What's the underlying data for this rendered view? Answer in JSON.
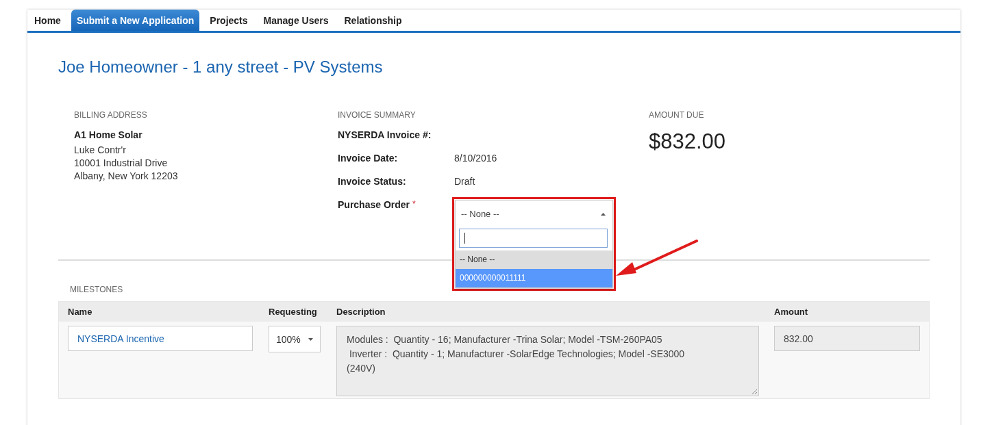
{
  "tabs": [
    {
      "label": "Home",
      "selected": false
    },
    {
      "label": "Submit a New Application",
      "selected": true
    },
    {
      "label": "Projects",
      "selected": false
    },
    {
      "label": "Manage Users",
      "selected": false
    },
    {
      "label": "Relationship",
      "selected": false
    }
  ],
  "title": "Joe Homeowner - 1 any street - PV Systems",
  "billing": {
    "heading": "BILLING ADDRESS",
    "company": "A1 Home Solar",
    "lines": [
      "Luke Contr'r",
      "10001 Industrial Drive",
      "Albany, New York 12203"
    ]
  },
  "invoice": {
    "heading": "INVOICE SUMMARY",
    "fields": [
      {
        "label": "NYSERDA Invoice #:"
      },
      {
        "label": "Invoice Date:",
        "value": "8/10/2016"
      },
      {
        "label": "Invoice Status:",
        "value": "Draft"
      }
    ],
    "purchase_order": {
      "label": "Purchase Order",
      "required_mark": "*",
      "value": "-- None --",
      "expanded": true,
      "options": [
        {
          "label": "-- None --",
          "selected": true,
          "highlighted": false
        },
        {
          "label": "000000000011111",
          "selected": false,
          "highlighted": true
        }
      ]
    }
  },
  "amount_due": {
    "heading": "AMOUNT DUE",
    "value": "$832.00"
  },
  "milestones": {
    "heading": "MILESTONES",
    "columns": [
      "Name",
      "Requesting",
      "Description",
      "Amount"
    ],
    "rows": [
      {
        "name": "NYSERDA Incentive",
        "requesting": "100%",
        "description": [
          "Modules :  Quantity - 16; Manufacturer -Trina Solar; Model -TSM-260PA05",
          " Inverter :  Quantity - 1; Manufacturer -SolarEdge Technologies; Model -SE3000",
          "(240V)"
        ],
        "amount": "832.00"
      }
    ]
  }
}
